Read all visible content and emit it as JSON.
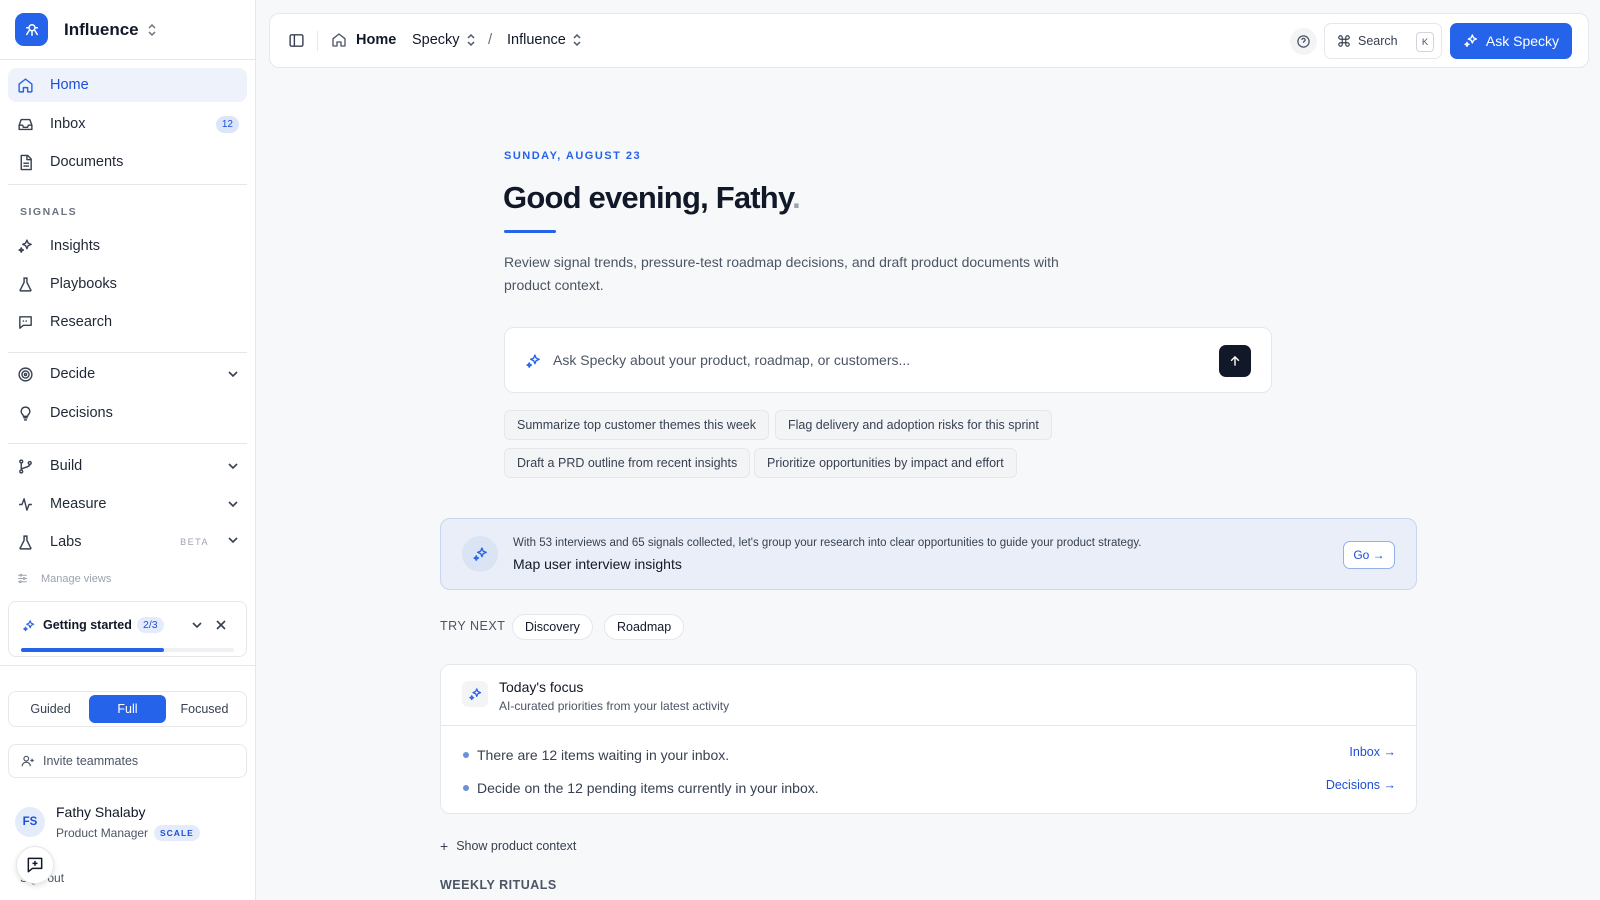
{
  "workspace": {
    "name": "Influence"
  },
  "nav": {
    "home": "Home",
    "inbox": "Inbox",
    "inbox_count": "12",
    "documents": "Documents",
    "signals_label": "SIGNALS",
    "insights": "Insights",
    "playbooks": "Playbooks",
    "research": "Research",
    "decide": "Decide",
    "decisions": "Decisions",
    "build": "Build",
    "measure": "Measure",
    "labs": "Labs",
    "labs_badge": "BETA",
    "manage_views": "Manage views"
  },
  "getting_started": {
    "title": "Getting started",
    "count": "2/3",
    "progress": 0.67
  },
  "view_modes": {
    "options": [
      "Guided",
      "Full",
      "Focused"
    ],
    "selected": "Full"
  },
  "invite": "Invite teammates",
  "user": {
    "initials": "FS",
    "name": "Fathy Shalaby",
    "role": "Product Manager",
    "plan": "SCALE",
    "signout": "Sign out"
  },
  "topbar": {
    "home": "Home",
    "org": "Specky",
    "workspace": "Influence",
    "search_label": "Search",
    "search_shortcut": "K",
    "ask_label": "Ask Specky"
  },
  "main": {
    "date": "SUNDAY, AUGUST 23",
    "greeting": "Good evening, Fathy",
    "greeting_dot": ".",
    "subtitle": "Review signal trends, pressure-test roadmap decisions, and draft product documents with product context.",
    "prompt_placeholder": "Ask Specky about your product, roadmap, or customers...",
    "chips": [
      "Summarize top customer themes this week",
      "Flag delivery and adoption risks for this sprint",
      "Draft a PRD outline from recent insights",
      "Prioritize opportunities by impact and effort"
    ],
    "banner": {
      "text": "With 53 interviews and 65 signals collected, let's group your research into clear opportunities to guide your product strategy.",
      "title": "Map user interview insights",
      "button": "Go"
    },
    "try_next": {
      "label": "TRY NEXT",
      "items": [
        "Discovery",
        "Roadmap"
      ]
    },
    "focus": {
      "title": "Today's focus",
      "subtitle": "AI-curated priorities from your latest activity",
      "items": [
        {
          "text": "There are 12 items waiting in your inbox.",
          "link": "Inbox"
        },
        {
          "text": "Decide on the 12 pending items currently in your inbox.",
          "link": "Decisions"
        }
      ]
    },
    "show_context": "Show product context",
    "weekly_label": "WEEKLY RITUALS"
  },
  "colors": {
    "accent": "#2563eb",
    "accent_dark": "#1d4ed8",
    "banner_bg": "#e9eef8"
  }
}
